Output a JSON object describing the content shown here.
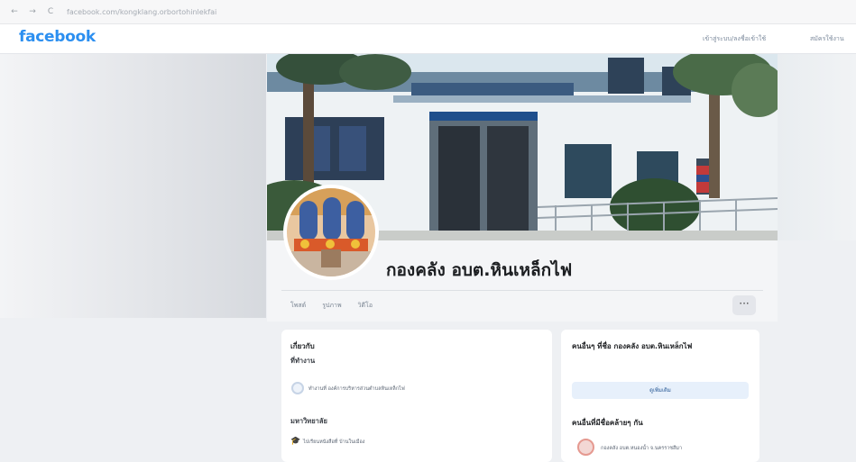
{
  "browser": {
    "back": "←",
    "forward": "→",
    "reload": "C",
    "url": "facebook.com/kongklang.orbortohinlekfai"
  },
  "header": {
    "logo": "facebook",
    "login_label": "เข้าสู่ระบบ/ลงชื่อเข้าใช้",
    "register_label": "สมัครใช้งาน"
  },
  "profile": {
    "name": "กองคลัง อบต.หินเหล็กไฟ"
  },
  "tabs": [
    "โพสต์",
    "รูปภาพ",
    "วิดีโอ"
  ],
  "more_button": "···",
  "intro": {
    "title": "เกี่ยวกับ",
    "subtitle": "ที่ทำงาน",
    "workplace": "ทำงานที่ องค์การบริหารส่วนตำบลหินเหล็กไฟ",
    "education_title": "มหาวิทยาลัย",
    "education_text": "ไปเรียนหนังสือที่ บ้านในเมือง"
  },
  "right_panel": {
    "title": "คนอื่นๆ ที่ชื่อ กองคลัง อบต.หินเหล็กไฟ",
    "button_label": "ดูเพิ่มเติม",
    "similar_title": "คนอื่นที่มีชื่อคล้ายๆ กัน",
    "person_name": "กองคลัง อบต.หนองน้ำ จ.นครราชสีมา"
  },
  "icons": {
    "workplace": "briefcase-icon",
    "education": "graduation-cap-icon"
  },
  "colors": {
    "brand": "#2c8ff0",
    "page_bg": "#eef0f3",
    "card_bg": "#ffffff"
  }
}
